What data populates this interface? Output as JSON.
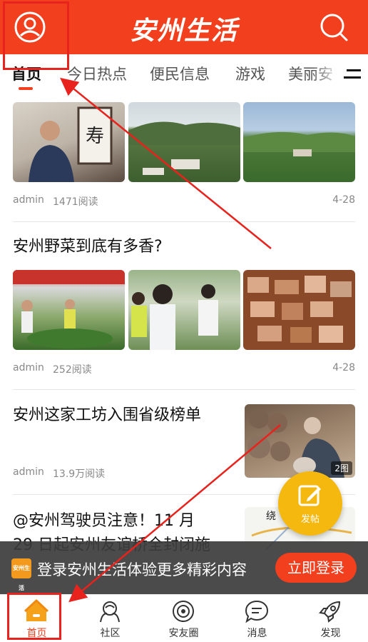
{
  "header": {
    "title": "安州生活",
    "user_icon": "user-icon",
    "search_icon": "search-icon"
  },
  "tabs": [
    "首页",
    "今日热点",
    "便民信息",
    "游戏",
    "美丽安"
  ],
  "feed": {
    "item1": {
      "author": "admin",
      "reads": "1471阅读",
      "date": "4-28"
    },
    "item2": {
      "title": "安州野菜到底有多香?",
      "author": "admin",
      "reads": "252阅读",
      "date": "4-28"
    },
    "item3": {
      "title": "安州这家工坊入围省级榜单",
      "author": "admin",
      "reads": "13.9万阅读",
      "image_badge": "2图"
    },
    "item4": {
      "title_line1": "@安州驾驶员注意！11 月",
      "title_line2": "29 日起安州友谊桥全封闭施",
      "thumb_text": "绕"
    }
  },
  "banner": {
    "logo_text": "安州生活",
    "text": "登录安州生活体验更多精彩内容",
    "login_label": "立即登录"
  },
  "fab": {
    "label": "发帖"
  },
  "bottom_nav": [
    {
      "label": "首页",
      "icon": "home-icon"
    },
    {
      "label": "社区",
      "icon": "community-icon"
    },
    {
      "label": "安友圈",
      "icon": "circle-icon"
    },
    {
      "label": "消息",
      "icon": "message-icon"
    },
    {
      "label": "发现",
      "icon": "rocket-icon"
    }
  ],
  "colors": {
    "brand": "#f23f1e",
    "fab": "#f5b80f",
    "annotation": "#e8221c"
  }
}
